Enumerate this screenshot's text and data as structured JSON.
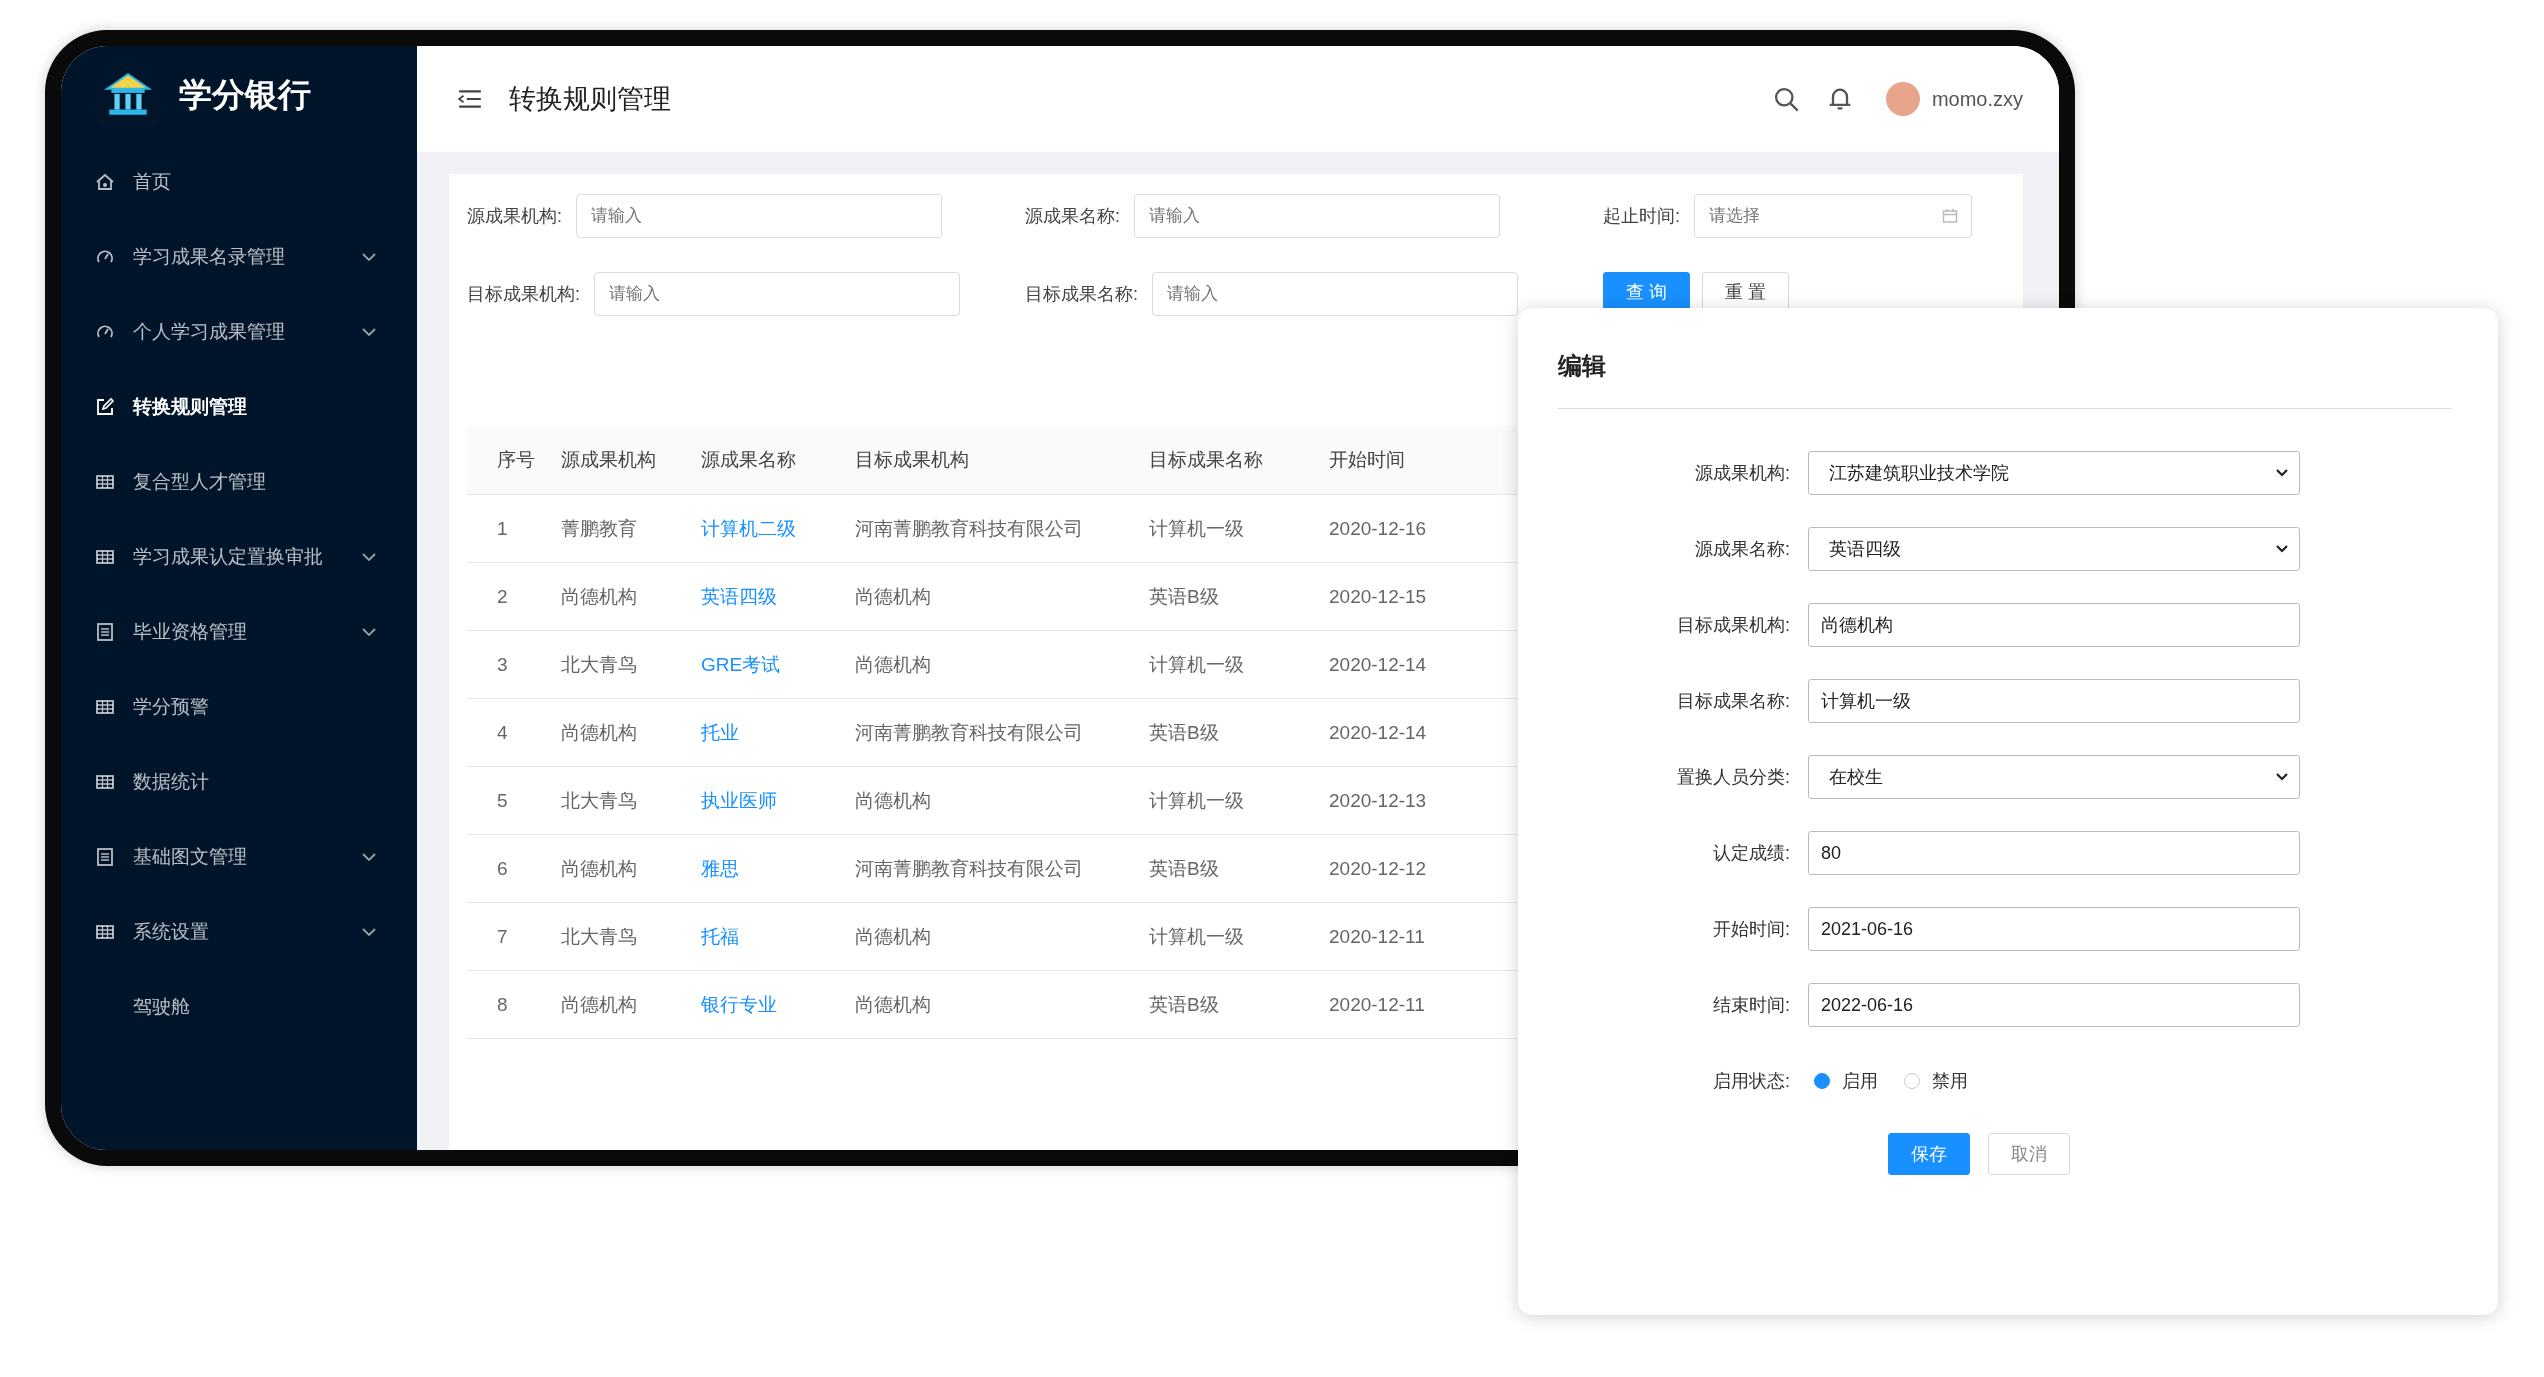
{
  "sidebar": {
    "logo_text": "学分银行",
    "items": [
      {
        "label": "首页",
        "kind": "home",
        "has_submenu": false,
        "selected": false
      },
      {
        "label": "学习成果名录管理",
        "kind": "gauge",
        "has_submenu": true,
        "selected": false
      },
      {
        "label": "个人学习成果管理",
        "kind": "gauge",
        "has_submenu": true,
        "selected": false
      },
      {
        "label": "转换规则管理",
        "kind": "edit",
        "has_submenu": false,
        "selected": true
      },
      {
        "label": "复合型人才管理",
        "kind": "table",
        "has_submenu": false,
        "selected": false
      },
      {
        "label": "学习成果认定置换审批",
        "kind": "table",
        "has_submenu": true,
        "selected": false
      },
      {
        "label": "毕业资格管理",
        "kind": "list",
        "has_submenu": true,
        "selected": false
      },
      {
        "label": "学分预警",
        "kind": "table",
        "has_submenu": false,
        "selected": false
      },
      {
        "label": "数据统计",
        "kind": "table",
        "has_submenu": false,
        "selected": false
      },
      {
        "label": "基础图文管理",
        "kind": "list",
        "has_submenu": true,
        "selected": false
      },
      {
        "label": "系统设置",
        "kind": "table",
        "has_submenu": true,
        "selected": false
      },
      {
        "label": "驾驶舱",
        "kind": "plain",
        "has_submenu": false,
        "selected": false
      }
    ]
  },
  "header": {
    "title": "转换规则管理",
    "user": "momo.zxy"
  },
  "filters": [
    {
      "label": "源成果机构:",
      "placeholder": "请输入",
      "kind": "text"
    },
    {
      "label": "源成果名称:",
      "placeholder": "请输入",
      "kind": "text"
    },
    {
      "label": "起止时间:",
      "placeholder": "请选择",
      "kind": "date"
    },
    {
      "label": "目标成果机构:",
      "placeholder": "请输入",
      "kind": "text"
    },
    {
      "label": "目标成果名称:",
      "placeholder": "请输入",
      "kind": "text"
    }
  ],
  "filter_buttons": [
    {
      "label": "查 询",
      "kind": "primary"
    },
    {
      "label": "重 置",
      "kind": "default"
    }
  ],
  "table": {
    "columns": [
      {
        "label": "序号",
        "kind": "text"
      },
      {
        "label": "源成果机构",
        "kind": "text"
      },
      {
        "label": "源成果名称",
        "kind": "link"
      },
      {
        "label": "目标成果机构",
        "kind": "text"
      },
      {
        "label": "目标成果名称",
        "kind": "text"
      },
      {
        "label": "开始时间",
        "kind": "text"
      }
    ],
    "rows": [
      [
        "1",
        "菁鹏教育",
        "计算机二级",
        "河南菁鹏教育科技有限公司",
        "计算机一级",
        "2020-12-16"
      ],
      [
        "2",
        "尚德机构",
        "英语四级",
        "尚德机构",
        "英语B级",
        "2020-12-15"
      ],
      [
        "3",
        "北大青鸟",
        "GRE考试",
        "尚德机构",
        "计算机一级",
        "2020-12-14"
      ],
      [
        "4",
        "尚德机构",
        "托业",
        "河南菁鹏教育科技有限公司",
        "英语B级",
        "2020-12-14"
      ],
      [
        "5",
        "北大青鸟",
        "执业医师",
        "尚德机构",
        "计算机一级",
        "2020-12-13"
      ],
      [
        "6",
        "尚德机构",
        "雅思",
        "河南菁鹏教育科技有限公司",
        "英语B级",
        "2020-12-12"
      ],
      [
        "7",
        "北大青鸟",
        "托福",
        "尚德机构",
        "计算机一级",
        "2020-12-11"
      ],
      [
        "8",
        "尚德机构",
        "银行专业",
        "尚德机构",
        "英语B级",
        "2020-12-11"
      ]
    ]
  },
  "dialog": {
    "title": "编辑",
    "fields": [
      {
        "label": "源成果机构:",
        "kind": "select",
        "value": "江苏建筑职业技术学院"
      },
      {
        "label": "源成果名称:",
        "kind": "select",
        "value": "英语四级"
      },
      {
        "label": "目标成果机构:",
        "kind": "input",
        "value": "尚德机构"
      },
      {
        "label": "目标成果名称:",
        "kind": "input",
        "value": "计算机一级"
      },
      {
        "label": "置换人员分类:",
        "kind": "select",
        "value": "在校生"
      },
      {
        "label": "认定成绩:",
        "kind": "input",
        "value": "80"
      },
      {
        "label": "开始时间:",
        "kind": "input",
        "value": "2021-06-16"
      },
      {
        "label": "结束时间:",
        "kind": "input",
        "value": "2022-06-16"
      }
    ],
    "status": {
      "label": "启用状态:",
      "options": [
        {
          "label": "启用",
          "selected": true
        },
        {
          "label": "禁用",
          "selected": false
        }
      ]
    },
    "buttons": [
      {
        "label": "保存",
        "kind": "primary"
      },
      {
        "label": "取消",
        "kind": "default"
      }
    ]
  }
}
